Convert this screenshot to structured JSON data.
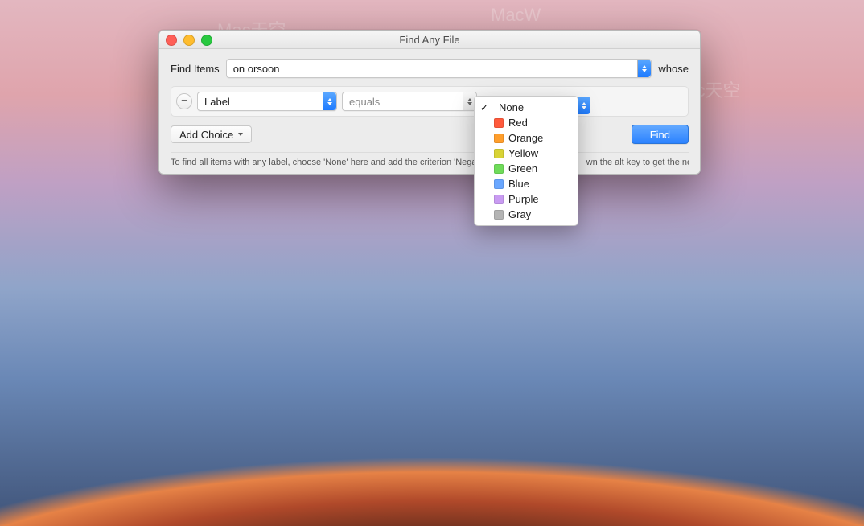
{
  "window": {
    "title": "Find Any File"
  },
  "row1": {
    "find_items_label": "Find Items",
    "location_value": "on orsoon",
    "whose_label": "whose"
  },
  "criteria": {
    "attribute_value": "Label",
    "operator_value": "equals"
  },
  "buttons": {
    "add_choice": "Add Choice",
    "find": "Find"
  },
  "hint": {
    "left": "To find all items with any label, choose 'None' here and add the criterion 'Nega",
    "right": "wn the alt key to get the nega"
  },
  "menu": {
    "items": [
      {
        "label": "None",
        "color": null,
        "checked": true
      },
      {
        "label": "Red",
        "color": "#ff5a3c",
        "checked": false
      },
      {
        "label": "Orange",
        "color": "#ff9e2c",
        "checked": false
      },
      {
        "label": "Yellow",
        "color": "#d8d336",
        "checked": false
      },
      {
        "label": "Green",
        "color": "#6fdc5a",
        "checked": false
      },
      {
        "label": "Blue",
        "color": "#6aa7ff",
        "checked": false
      },
      {
        "label": "Purple",
        "color": "#c99bf2",
        "checked": false
      },
      {
        "label": "Gray",
        "color": "#b4b4b4",
        "checked": false
      }
    ]
  },
  "watermarks": [
    "Mac天空",
    "Mac天空",
    "MacW"
  ]
}
